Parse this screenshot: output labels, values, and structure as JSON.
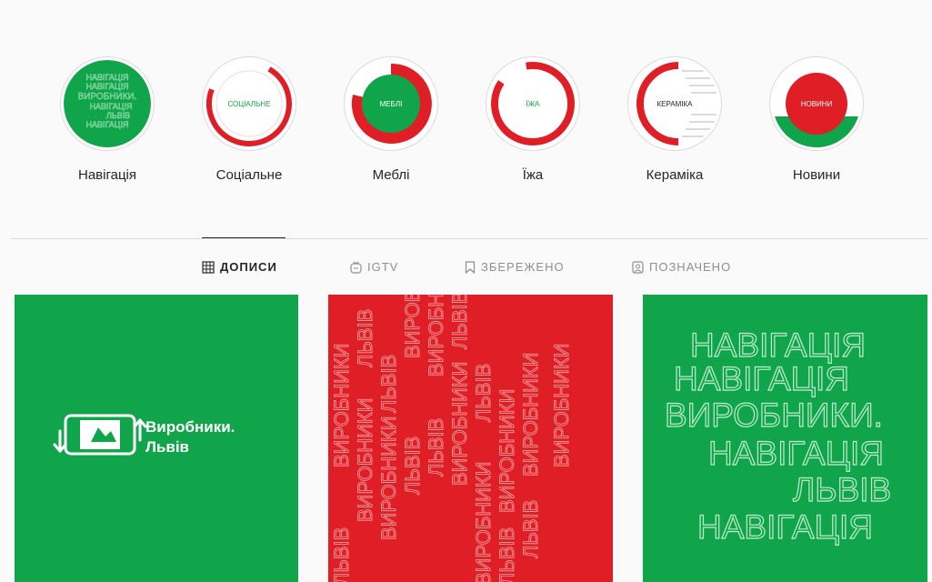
{
  "colors": {
    "green": "#10a54a",
    "red": "#e01e25",
    "text": "#262626",
    "muted": "#8e8e8e",
    "divider": "#dbdbdb"
  },
  "highlights": [
    {
      "label": "Навігація",
      "cover": [
        "НАВІГАЦІЯ",
        "НАВІГАЦІЯ",
        "ВИРОБНИКИ.",
        "НАВІГАЦІЯ",
        "ЛЬВІВ",
        "НАВІГАЦІЯ"
      ]
    },
    {
      "label": "Соціальне",
      "cover": "СОЦІАЛЬНЕ"
    },
    {
      "label": "Меблі",
      "cover": "МЕБЛІ"
    },
    {
      "label": "Їжа",
      "cover": "ЇЖА"
    },
    {
      "label": "Кераміка",
      "cover": "КЕРАМІКА"
    },
    {
      "label": "Новини",
      "cover": "НОВИНИ"
    }
  ],
  "tabs": [
    {
      "label": "ДОПИСИ",
      "icon": "grid-icon",
      "active": true
    },
    {
      "label": "IGTV",
      "icon": "igtv-icon",
      "active": false
    },
    {
      "label": "ЗБЕРЕЖЕНО",
      "icon": "bookmark-icon",
      "active": false
    },
    {
      "label": "ПОЗНАЧЕНО",
      "icon": "tagged-icon",
      "active": false
    }
  ],
  "posts": [
    {
      "logo_line1": "Виробники.",
      "logo_line2": "Львів"
    },
    {
      "pattern_words": [
        "ВИРОБНИКИ",
        "ЛЬВІВ"
      ]
    },
    {
      "lines": [
        "НАВІГАЦІЯ",
        "НАВІГАЦІЯ",
        "ВИРОБНИКИ.",
        "НАВІГАЦІЯ",
        "ЛЬВІВ",
        "НАВІГАЦІЯ"
      ]
    }
  ]
}
